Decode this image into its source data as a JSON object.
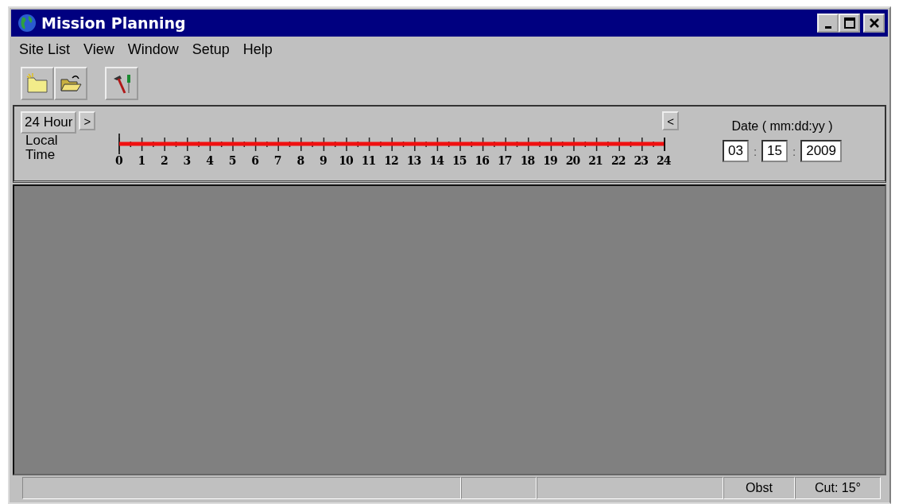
{
  "window": {
    "title": "Mission Planning"
  },
  "menu": [
    "Site List",
    "View",
    "Window",
    "Setup",
    "Help"
  ],
  "timeline": {
    "range_button": "24 Hour",
    "scroll_right": ">",
    "scroll_left": "<",
    "axis_label": "Local Time",
    "hours": [
      "0",
      "1",
      "2",
      "3",
      "4",
      "5",
      "6",
      "7",
      "8",
      "9",
      "10",
      "11",
      "12",
      "13",
      "14",
      "15",
      "16",
      "17",
      "18",
      "19",
      "20",
      "21",
      "22",
      "23",
      "24"
    ],
    "date_label": "Date ( mm:dd:yy )",
    "date": {
      "month": "03",
      "day": "15",
      "year": "2009"
    },
    "separators": [
      ":",
      ":"
    ]
  },
  "status_bar": [
    "Obst",
    "Cut: 15°"
  ]
}
